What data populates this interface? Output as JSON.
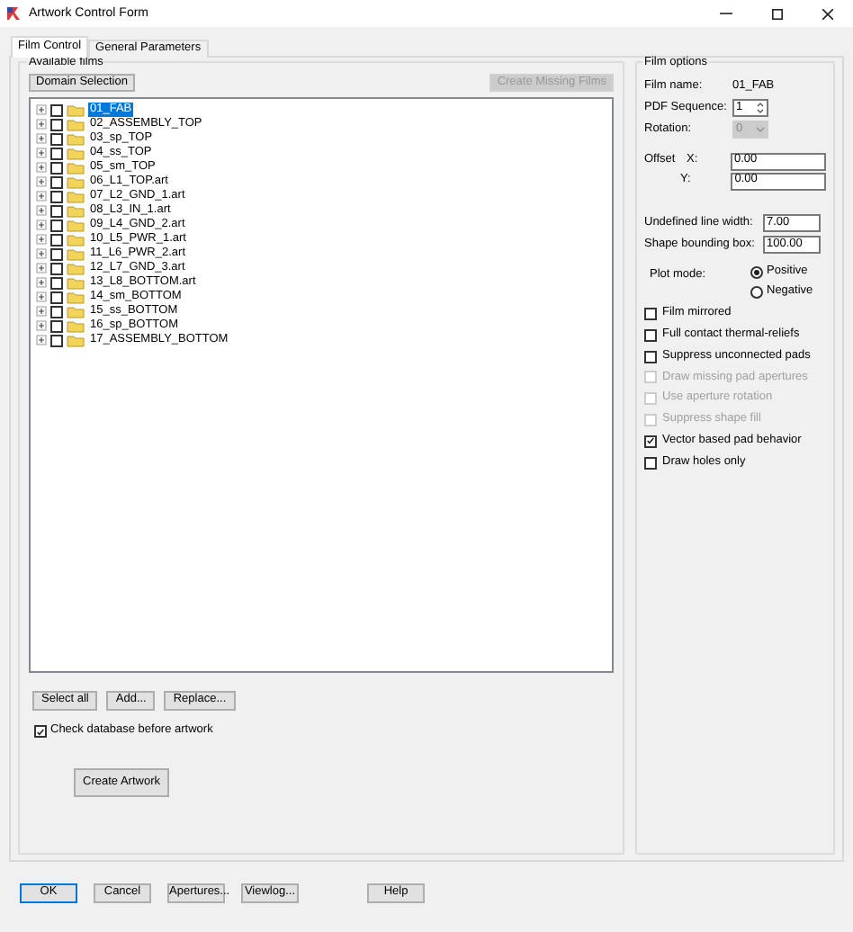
{
  "window": {
    "title": "Artwork Control Form"
  },
  "tabs": [
    {
      "label": "Film Control",
      "selected": true
    },
    {
      "label": "General Parameters",
      "selected": false
    }
  ],
  "available_films": {
    "title": "Available films",
    "domain_button": {
      "label": "Domain Selection",
      "disabled": false
    },
    "create_missing_button": {
      "label": "Create Missing Films",
      "disabled": true
    },
    "films": [
      {
        "label": "01_FAB",
        "selected": true,
        "checked": false,
        "expanded": false
      },
      {
        "label": "02_ASSEMBLY_TOP",
        "selected": false,
        "checked": false,
        "expanded": false
      },
      {
        "label": "03_sp_TOP",
        "selected": false,
        "checked": false,
        "expanded": false
      },
      {
        "label": "04_ss_TOP",
        "selected": false,
        "checked": false,
        "expanded": false
      },
      {
        "label": "05_sm_TOP",
        "selected": false,
        "checked": false,
        "expanded": false
      },
      {
        "label": "06_L1_TOP.art",
        "selected": false,
        "checked": false,
        "expanded": false
      },
      {
        "label": "07_L2_GND_1.art",
        "selected": false,
        "checked": false,
        "expanded": false
      },
      {
        "label": "08_L3_IN_1.art",
        "selected": false,
        "checked": false,
        "expanded": false
      },
      {
        "label": "09_L4_GND_2.art",
        "selected": false,
        "checked": false,
        "expanded": false
      },
      {
        "label": "10_L5_PWR_1.art",
        "selected": false,
        "checked": false,
        "expanded": false
      },
      {
        "label": "11_L6_PWR_2.art",
        "selected": false,
        "checked": false,
        "expanded": false
      },
      {
        "label": "12_L7_GND_3.art",
        "selected": false,
        "checked": false,
        "expanded": false
      },
      {
        "label": "13_L8_BOTTOM.art",
        "selected": false,
        "checked": false,
        "expanded": false
      },
      {
        "label": "14_sm_BOTTOM",
        "selected": false,
        "checked": false,
        "expanded": false
      },
      {
        "label": "15_ss_BOTTOM",
        "selected": false,
        "checked": false,
        "expanded": false
      },
      {
        "label": "16_sp_BOTTOM",
        "selected": false,
        "checked": false,
        "expanded": false
      },
      {
        "label": "17_ASSEMBLY_BOTTOM",
        "selected": false,
        "checked": false,
        "expanded": false
      }
    ],
    "list_buttons": [
      "Select all",
      "Add...",
      "Replace..."
    ],
    "check_database": {
      "label": "Check database before artwork",
      "checked": true
    },
    "create_artwork_button": "Create Artwork"
  },
  "film_options": {
    "title": "Film options",
    "film_name": {
      "label": "Film name:",
      "value": "01_FAB"
    },
    "pdf_sequence": {
      "label": "PDF Sequence:",
      "value": "1"
    },
    "rotation": {
      "label": "Rotation:",
      "value": "0",
      "disabled": true
    },
    "offset": {
      "label": "Offset",
      "x_label": "X:",
      "x_value": "0.00",
      "y_label": "Y:",
      "y_value": "0.00"
    },
    "undefined_line_width": {
      "label": "Undefined line width:",
      "value": "7.00"
    },
    "shape_bounding_box": {
      "label": "Shape bounding box:",
      "value": "100.00"
    },
    "plot_mode": {
      "label": "Plot mode:",
      "options": [
        {
          "label": "Positive",
          "selected": true
        },
        {
          "label": "Negative",
          "selected": false
        }
      ]
    },
    "checkboxes": [
      {
        "label": "Film mirrored",
        "checked": false,
        "disabled": false
      },
      {
        "label": "Full contact thermal-reliefs",
        "checked": false,
        "disabled": false
      },
      {
        "label": "Suppress unconnected pads",
        "checked": false,
        "disabled": false
      },
      {
        "label": "Draw missing pad apertures",
        "checked": false,
        "disabled": true
      },
      {
        "label": "Use aperture rotation",
        "checked": false,
        "disabled": true
      },
      {
        "label": "Suppress shape fill",
        "checked": false,
        "disabled": true
      },
      {
        "label": "Vector based pad behavior",
        "checked": true,
        "disabled": false
      },
      {
        "label": "Draw holes only",
        "checked": false,
        "disabled": false
      }
    ]
  },
  "footer_buttons": [
    {
      "label": "OK",
      "default": true
    },
    {
      "label": "Cancel",
      "default": false
    },
    {
      "label": "Apertures...",
      "default": false
    },
    {
      "label": "Viewlog...",
      "default": false
    },
    {
      "label": "Help",
      "default": false
    }
  ]
}
